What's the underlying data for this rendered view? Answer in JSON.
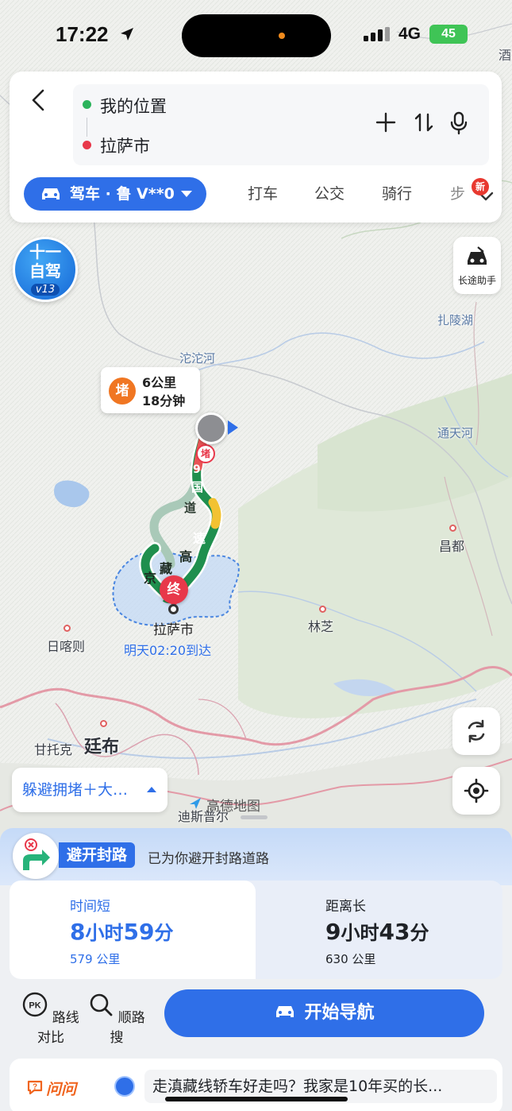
{
  "status_bar": {
    "time": "17:22",
    "network": "4G",
    "battery": "45"
  },
  "route_card": {
    "origin": "我的位置",
    "destination": "拉萨市",
    "modes": {
      "active": "驾车 · 鲁 V**0",
      "taxi": "打车",
      "bus": "公交",
      "bike": "骑行",
      "walk": "步"
    },
    "new_badge": "新"
  },
  "side": {
    "promo_line1": "十一",
    "promo_line2": "自驾",
    "promo_line3": "v13",
    "longtrip_label": "长途助手"
  },
  "map": {
    "labels": {
      "tuotuo": "沱沱河",
      "zhaling": "扎陵湖",
      "tongtian": "通天河",
      "changdu": "昌都",
      "linzhi": "林芝",
      "rikaze": "日喀则",
      "gantuoke": "甘托克",
      "tingbu": "廷布",
      "corner": "酒",
      "bottom_cut": "迪斯普尔"
    },
    "jam": {
      "icon": "堵",
      "distance": "6公里",
      "duration": "18分钟"
    },
    "road_shield": "堵",
    "road_name_1": "9",
    "road_name_2": "国",
    "road_name_3": "道",
    "highway": [
      "京",
      "藏",
      "高",
      "速"
    ],
    "end_pin": "终",
    "destination_label": "拉萨市",
    "arrival": "明天02:20到达",
    "avoid_pill": "躲避拥堵＋大…",
    "brand": "高德地图"
  },
  "sheet": {
    "closed_tag": "避开封路",
    "closed_text": "已为你避开封路道路",
    "routes": [
      {
        "tag": "时间短",
        "hours": "8",
        "mins": "59",
        "distance": "579 公里"
      },
      {
        "tag": "距离长",
        "hours": "9",
        "mins": "43",
        "distance": "630 公里"
      }
    ],
    "unit_hour": "小时",
    "unit_min": "分",
    "tools": {
      "compare": "路线对比",
      "along": "顺路搜",
      "pk": "PK"
    },
    "start_nav": "开始导航",
    "ask_logo": "问问",
    "ask_question": "走滇藏线轿车好走吗？我家是10年买的长..."
  },
  "colors": {
    "accent": "#2f6fe8",
    "route_green": "#1f8f4e",
    "jam_orange": "#f07622",
    "end_red": "#e8384a"
  }
}
